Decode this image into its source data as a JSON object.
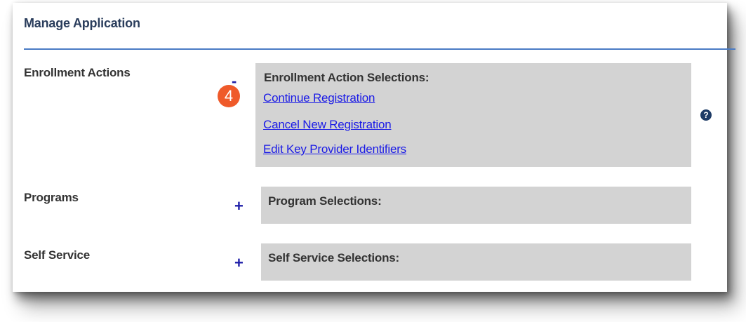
{
  "panel": {
    "title": "Manage Application"
  },
  "rows": {
    "enrollment": {
      "label": "Enrollment Actions",
      "toggle": "-",
      "selections_title": "Enrollment Action Selections:",
      "links": [
        "Continue Registration",
        "Cancel New Registration",
        "Edit Key Provider Identifiers"
      ]
    },
    "programs": {
      "label": "Programs",
      "toggle": "+",
      "selections_title": "Program Selections:"
    },
    "self_service": {
      "label": "Self Service",
      "toggle": "+",
      "selections_title": "Self Service Selections:"
    }
  },
  "annotation": {
    "step_badge": "4"
  },
  "help": {
    "icon": "question-circle-icon",
    "glyph": "?"
  },
  "colors": {
    "title": "#2a3d5c",
    "rule": "#4a7bc4",
    "link": "#1a1ae6",
    "toggle": "#1f1fa8",
    "box": "#d3d3d3",
    "badge": "#ef5a2a"
  }
}
